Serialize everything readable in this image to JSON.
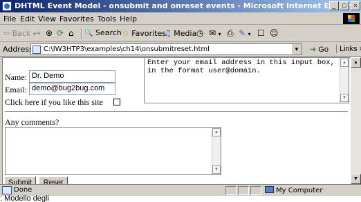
{
  "window": {
    "title": "DHTML Event Model - onsubmit and onreset events - Microsoft Internet Explorer",
    "minimize_glyph": "_",
    "maximize_glyph": "□",
    "close_glyph": "×"
  },
  "menubar": {
    "items": [
      "File",
      "Edit",
      "View",
      "Favorites",
      "Tools",
      "Help"
    ]
  },
  "toolbar": {
    "back_label": "Back",
    "back_glyph": "⇦",
    "forward_glyph": "→",
    "stop_glyph": "⊗",
    "refresh_glyph": "⟳",
    "home_glyph": "⌂",
    "search_label": "Search",
    "search_glyph": "🔍",
    "favorites_label": "Favorites",
    "favorites_glyph": "☆",
    "media_label": "Media",
    "media_glyph": "♫",
    "history_glyph": "◷",
    "mail_glyph": "✉",
    "print_glyph": "⎙",
    "edit_glyph": "✎",
    "discuss_glyph": "☐",
    "messenger_glyph": "☺"
  },
  "addressbar": {
    "label": "Address",
    "url": "C:\\IW3HTP3\\examples\\ch14\\onsubmitreset.html",
    "dropdown_glyph": "▼",
    "go_label": "Go",
    "go_glyph": "➜",
    "links_label": "Links",
    "links_glyph": "»"
  },
  "form": {
    "name_label": "Name:",
    "name_value": "Dr. Demo",
    "email_label": "Email:",
    "email_value": "demo@bug2bug.com",
    "like_label": "Click here if you like this site",
    "like_checked": false,
    "hint_text": "Enter your email address in this input box,\nin the format user@domain.",
    "comments_label": "Any comments?",
    "comments_value": "",
    "submit_label": "Submit",
    "reset_label": "Reset",
    "scroll_up_glyph": "▲",
    "scroll_down_glyph": "▼"
  },
  "statusbar": {
    "status_text": "Done",
    "zone_text": "My Computer"
  },
  "caption": ": Modello degli"
}
